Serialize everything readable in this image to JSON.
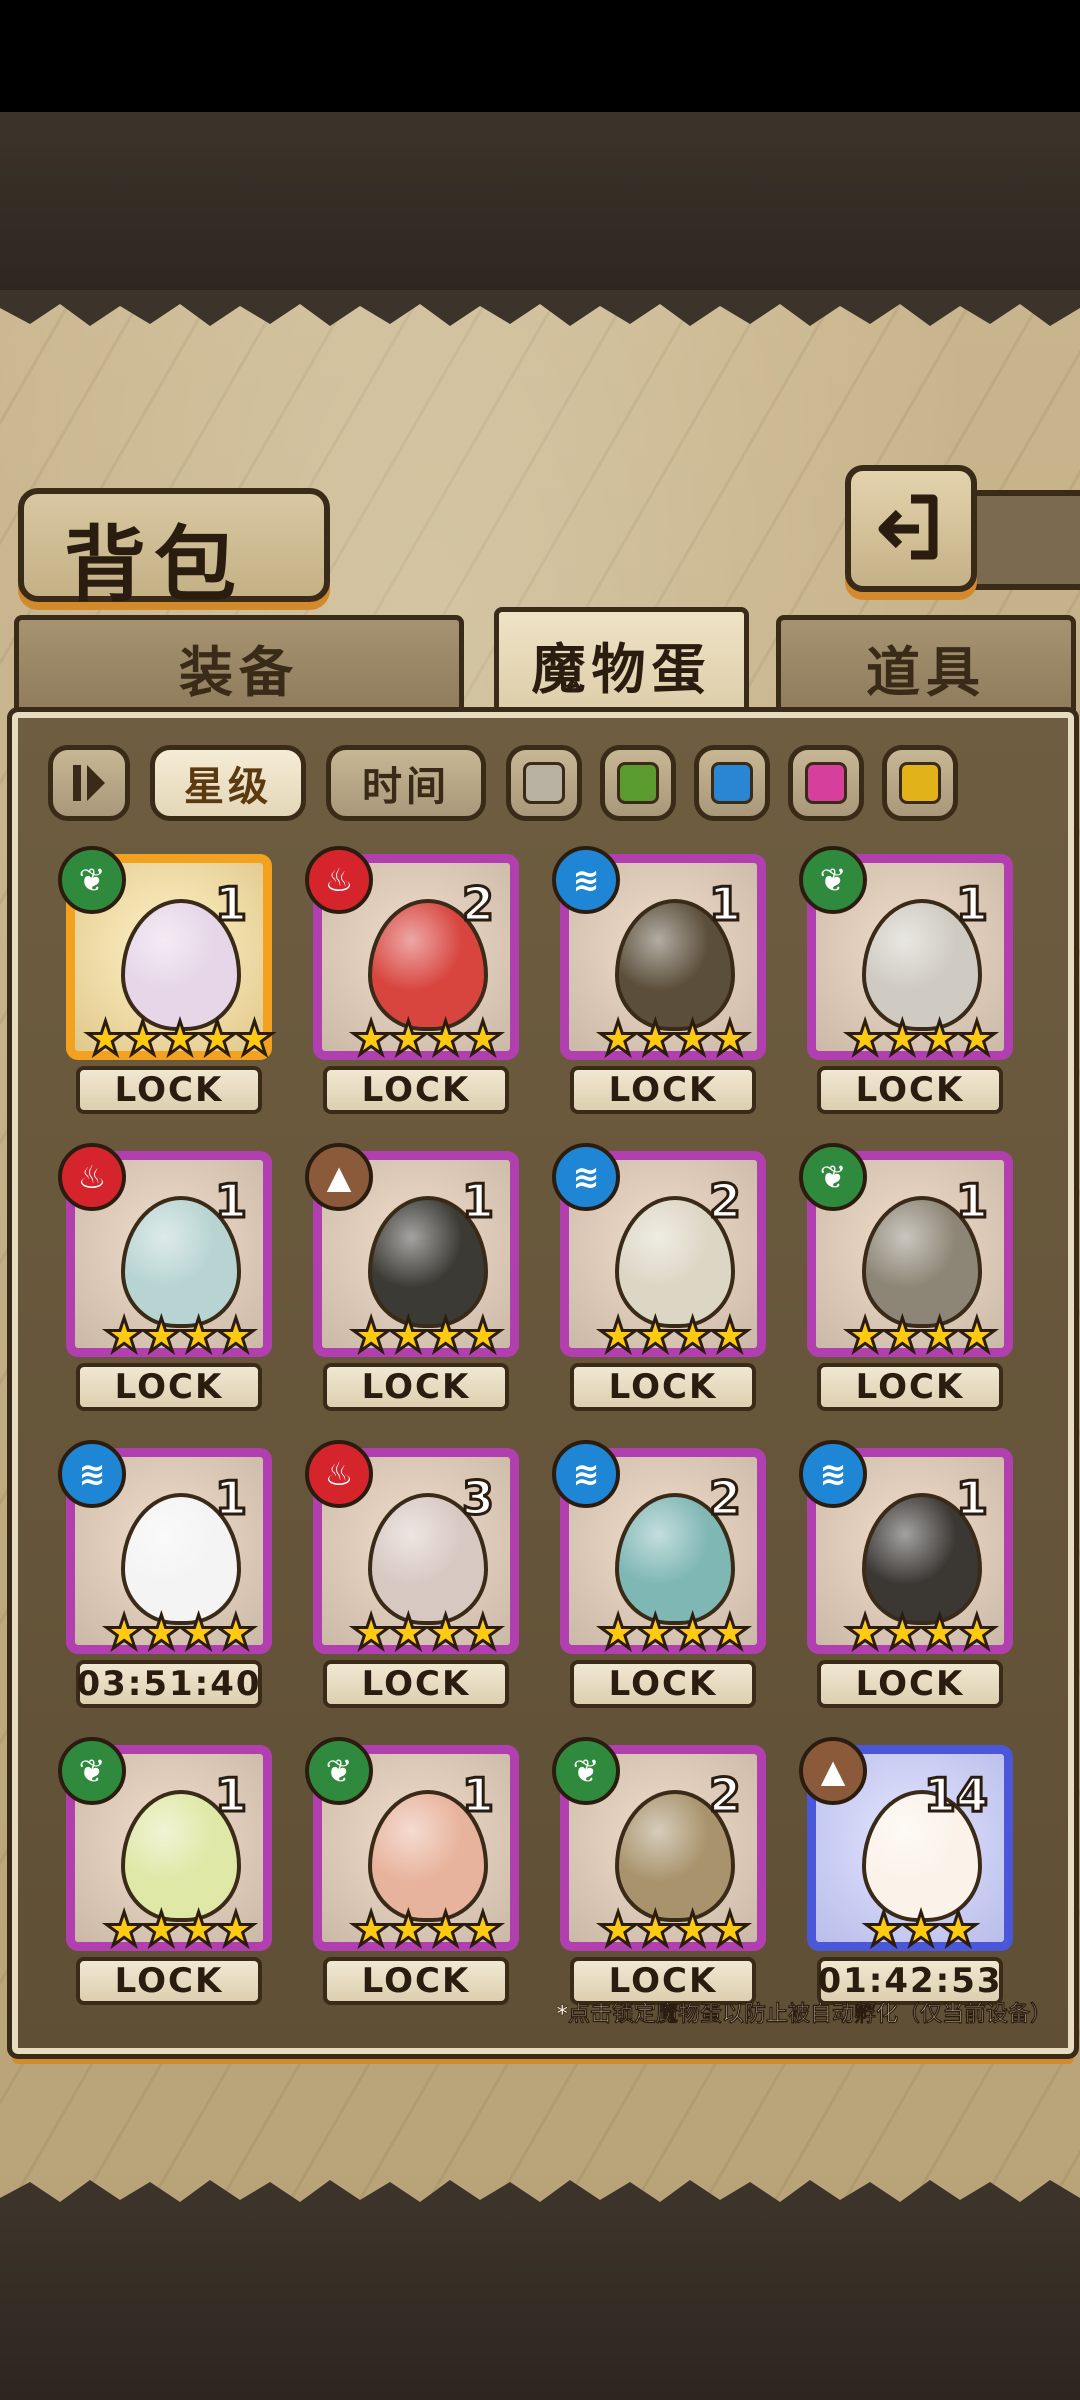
{
  "title": "背包",
  "tabs": [
    {
      "label": "装备",
      "active": false
    },
    {
      "label": "魔物蛋",
      "active": true
    },
    {
      "label": "道具",
      "active": false
    }
  ],
  "sort": {
    "star_label": "星级",
    "time_label": "时间"
  },
  "filters": [
    {
      "name": "gray",
      "color": "#b8b0a0"
    },
    {
      "name": "green",
      "color": "#5b9a2e"
    },
    {
      "name": "blue",
      "color": "#2a86d2"
    },
    {
      "name": "pink",
      "color": "#d63f9c"
    },
    {
      "name": "yellow",
      "color": "#e2b21a"
    }
  ],
  "eggs": [
    {
      "element": "leaf",
      "count": "1",
      "stars": 5,
      "label": "LOCK",
      "frame": "gold",
      "egg_color": "#e6d6e8"
    },
    {
      "element": "fire",
      "count": "2",
      "stars": 4,
      "label": "LOCK",
      "frame": "purple",
      "egg_color": "#d8453f"
    },
    {
      "element": "water",
      "count": "1",
      "stars": 4,
      "label": "LOCK",
      "frame": "purple",
      "egg_color": "#5b4e3a"
    },
    {
      "element": "leaf",
      "count": "1",
      "stars": 4,
      "label": "LOCK",
      "frame": "purple",
      "egg_color": "#cfcbc2"
    },
    {
      "element": "fire",
      "count": "1",
      "stars": 4,
      "label": "LOCK",
      "frame": "purple",
      "egg_color": "#b7d4d2"
    },
    {
      "element": "earth",
      "count": "1",
      "stars": 4,
      "label": "LOCK",
      "frame": "purple",
      "egg_color": "#3b3a35"
    },
    {
      "element": "water",
      "count": "2",
      "stars": 4,
      "label": "LOCK",
      "frame": "purple",
      "egg_color": "#dcd6c4"
    },
    {
      "element": "leaf",
      "count": "1",
      "stars": 4,
      "label": "LOCK",
      "frame": "purple",
      "egg_color": "#8d8676"
    },
    {
      "element": "water",
      "count": "1",
      "stars": 4,
      "label": "03:51:40",
      "frame": "purple",
      "egg_color": "#f4f4f4"
    },
    {
      "element": "fire",
      "count": "3",
      "stars": 4,
      "label": "LOCK",
      "frame": "purple",
      "egg_color": "#d8c8c2"
    },
    {
      "element": "water",
      "count": "2",
      "stars": 4,
      "label": "LOCK",
      "frame": "purple",
      "egg_color": "#7fb7b5"
    },
    {
      "element": "water",
      "count": "1",
      "stars": 4,
      "label": "LOCK",
      "frame": "purple",
      "egg_color": "#3b3834"
    },
    {
      "element": "leaf",
      "count": "1",
      "stars": 4,
      "label": "LOCK",
      "frame": "purple",
      "egg_color": "#dfe8a6"
    },
    {
      "element": "leaf",
      "count": "1",
      "stars": 4,
      "label": "LOCK",
      "frame": "purple",
      "egg_color": "#e8b39c"
    },
    {
      "element": "leaf",
      "count": "2",
      "stars": 4,
      "label": "LOCK",
      "frame": "purple",
      "egg_color": "#a8936c"
    },
    {
      "element": "earth",
      "count": "14",
      "stars": 3,
      "label": "01:42:53",
      "frame": "blue",
      "egg_color": "#fbf3ea"
    }
  ],
  "footnote": "*点击锁定魔物蛋以防止被自动孵化（仅当前设备）"
}
